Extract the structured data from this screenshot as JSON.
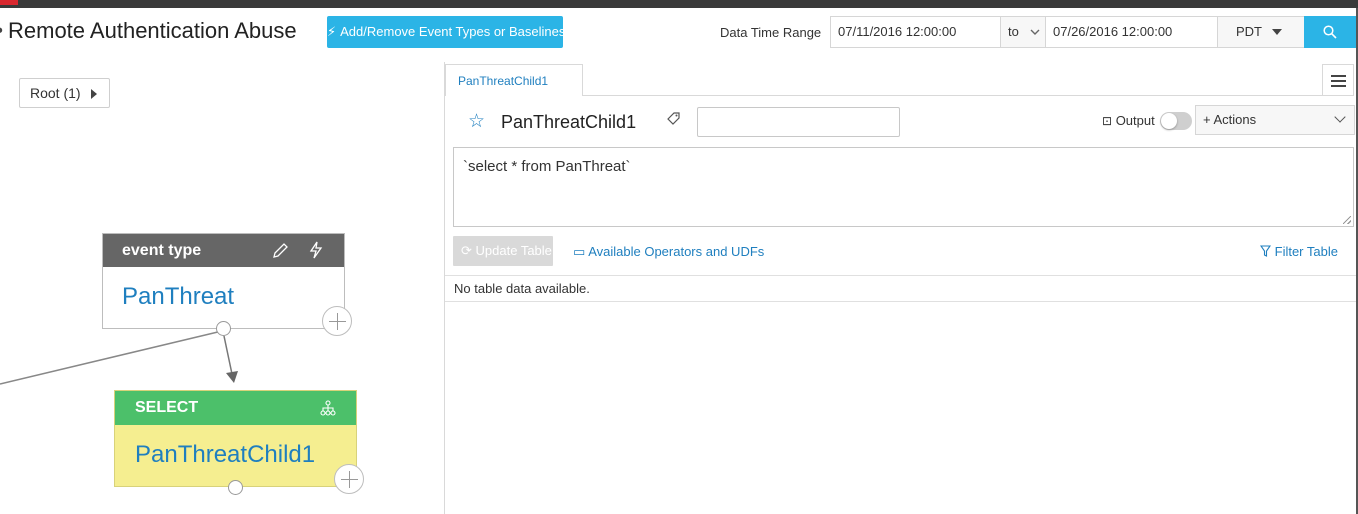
{
  "header": {
    "title": "Remote Authentication Abuse",
    "add_button_label": "Add/Remove Event Types or Baselines",
    "data_time_range_label": "Data Time Range",
    "start_datetime": "07/11/2016 12:00:00",
    "to_label": "to",
    "end_datetime": "07/26/2016 12:00:00",
    "timezone": "PDT"
  },
  "graph": {
    "root_label": "Root (1)",
    "event_node": {
      "header": "event type",
      "name": "PanThreat"
    },
    "select_node": {
      "header": "SELECT",
      "name": "PanThreatChild1"
    }
  },
  "editor": {
    "tab_label": "PanThreatChild1",
    "query_name": "PanThreatChild1",
    "name_input_value": "",
    "output_label": "Output",
    "output_enabled": false,
    "actions_label": "+ Actions",
    "sql": "`select * from PanThreat`",
    "update_table_label": "Update Table",
    "operators_link": "Available Operators and UDFs",
    "filter_link": "Filter Table",
    "empty_message": "No table data available."
  },
  "colors": {
    "accent": "#2bb4e6",
    "link": "#1f7fbf",
    "event_header": "#666666",
    "select_header": "#4cc06a",
    "select_body": "#f5ee90"
  },
  "icons": [
    "lightning-icon",
    "search-icon",
    "chevron-down-icon",
    "caret-right-icon",
    "pencil-icon",
    "hierarchy-icon",
    "plus-circle-icon",
    "star-icon",
    "tag-icon",
    "export-icon",
    "hamburger-icon",
    "refresh-icon",
    "book-icon",
    "filter-icon"
  ]
}
